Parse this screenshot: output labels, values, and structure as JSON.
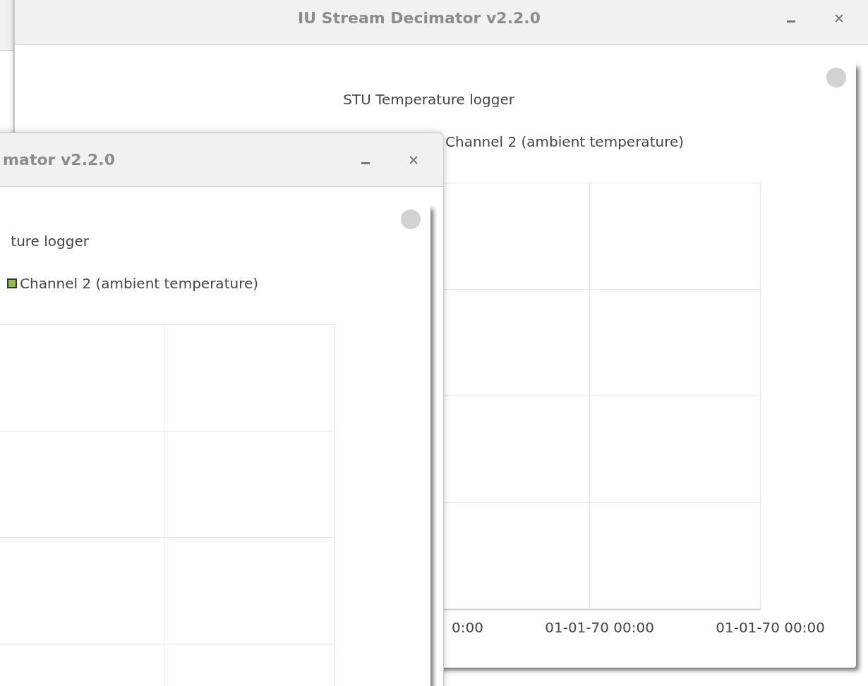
{
  "windows": [
    {
      "title": "IU Stream Decimator v2.2.0",
      "card": {
        "title": "STU Temperature logger",
        "legend": [
          {
            "label": "Channel 2 (ambient temperature)"
          }
        ],
        "x_tick_labels": [
          "0:00",
          "01-01-70 00:00",
          "01-01-70 00:00"
        ]
      }
    },
    {
      "title": "mator v2.2.0",
      "card": {
        "title": "ture logger",
        "legend": [
          {
            "label": "Channel 2 (ambient temperature)",
            "color": "#8bc34a"
          }
        ]
      }
    }
  ]
}
